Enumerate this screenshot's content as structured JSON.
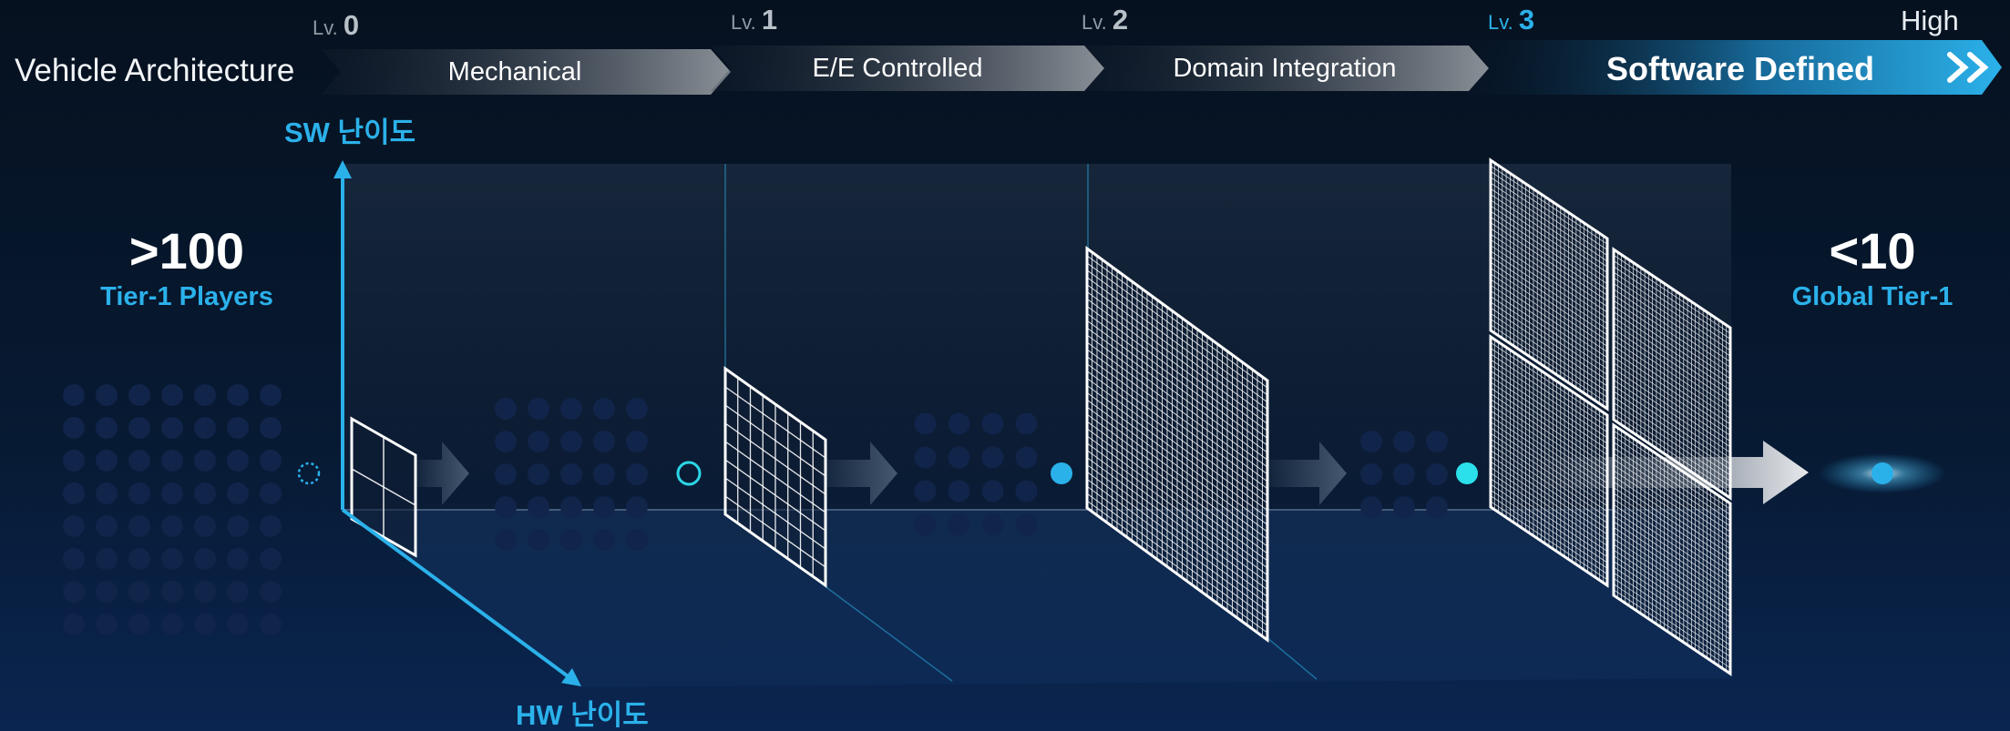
{
  "header": {
    "architecture_label": "Vehicle Architecture",
    "high_label": "High",
    "levels": [
      {
        "prefix": "Lv.",
        "number": "0"
      },
      {
        "prefix": "Lv.",
        "number": "1"
      },
      {
        "prefix": "Lv.",
        "number": "2"
      },
      {
        "prefix": "Lv.",
        "number": "3"
      }
    ],
    "segments": [
      {
        "label": "Mechanical"
      },
      {
        "label": "E/E Controlled"
      },
      {
        "label": "Domain Integration"
      },
      {
        "label": "Software Defined"
      }
    ],
    "segment_colors": [
      "#6b7178",
      "#8a9097",
      "#2bb1ea"
    ]
  },
  "axes": {
    "sw_label": "SW 난이도",
    "hw_label": "HW 난이도",
    "color": "#2bb1ea"
  },
  "left_stat": {
    "value": ">100",
    "label": "Tier-1 Players"
  },
  "right_stat": {
    "value": "<10",
    "label": "Global Tier-1"
  },
  "supplier_dots": {
    "groups": [
      {
        "cols": 7,
        "rows": 8
      },
      {
        "cols": 5,
        "rows": 5
      },
      {
        "cols": 4,
        "rows": 4
      },
      {
        "cols": 3,
        "rows": 3
      }
    ],
    "color": "#11244a"
  },
  "panels": [
    {
      "grid": 2
    },
    {
      "grid": 8
    },
    {
      "grid": 36
    },
    {
      "grid": 30
    }
  ],
  "markers": [
    {
      "style": "dashed-ring",
      "color": "#2bb1ea"
    },
    {
      "style": "ring",
      "color": "#2bd6e6"
    },
    {
      "style": "filled",
      "color": "#2bb1ea"
    },
    {
      "style": "filled",
      "color": "#2be0ea"
    },
    {
      "style": "glow",
      "color": "#2bb1ea"
    }
  ]
}
